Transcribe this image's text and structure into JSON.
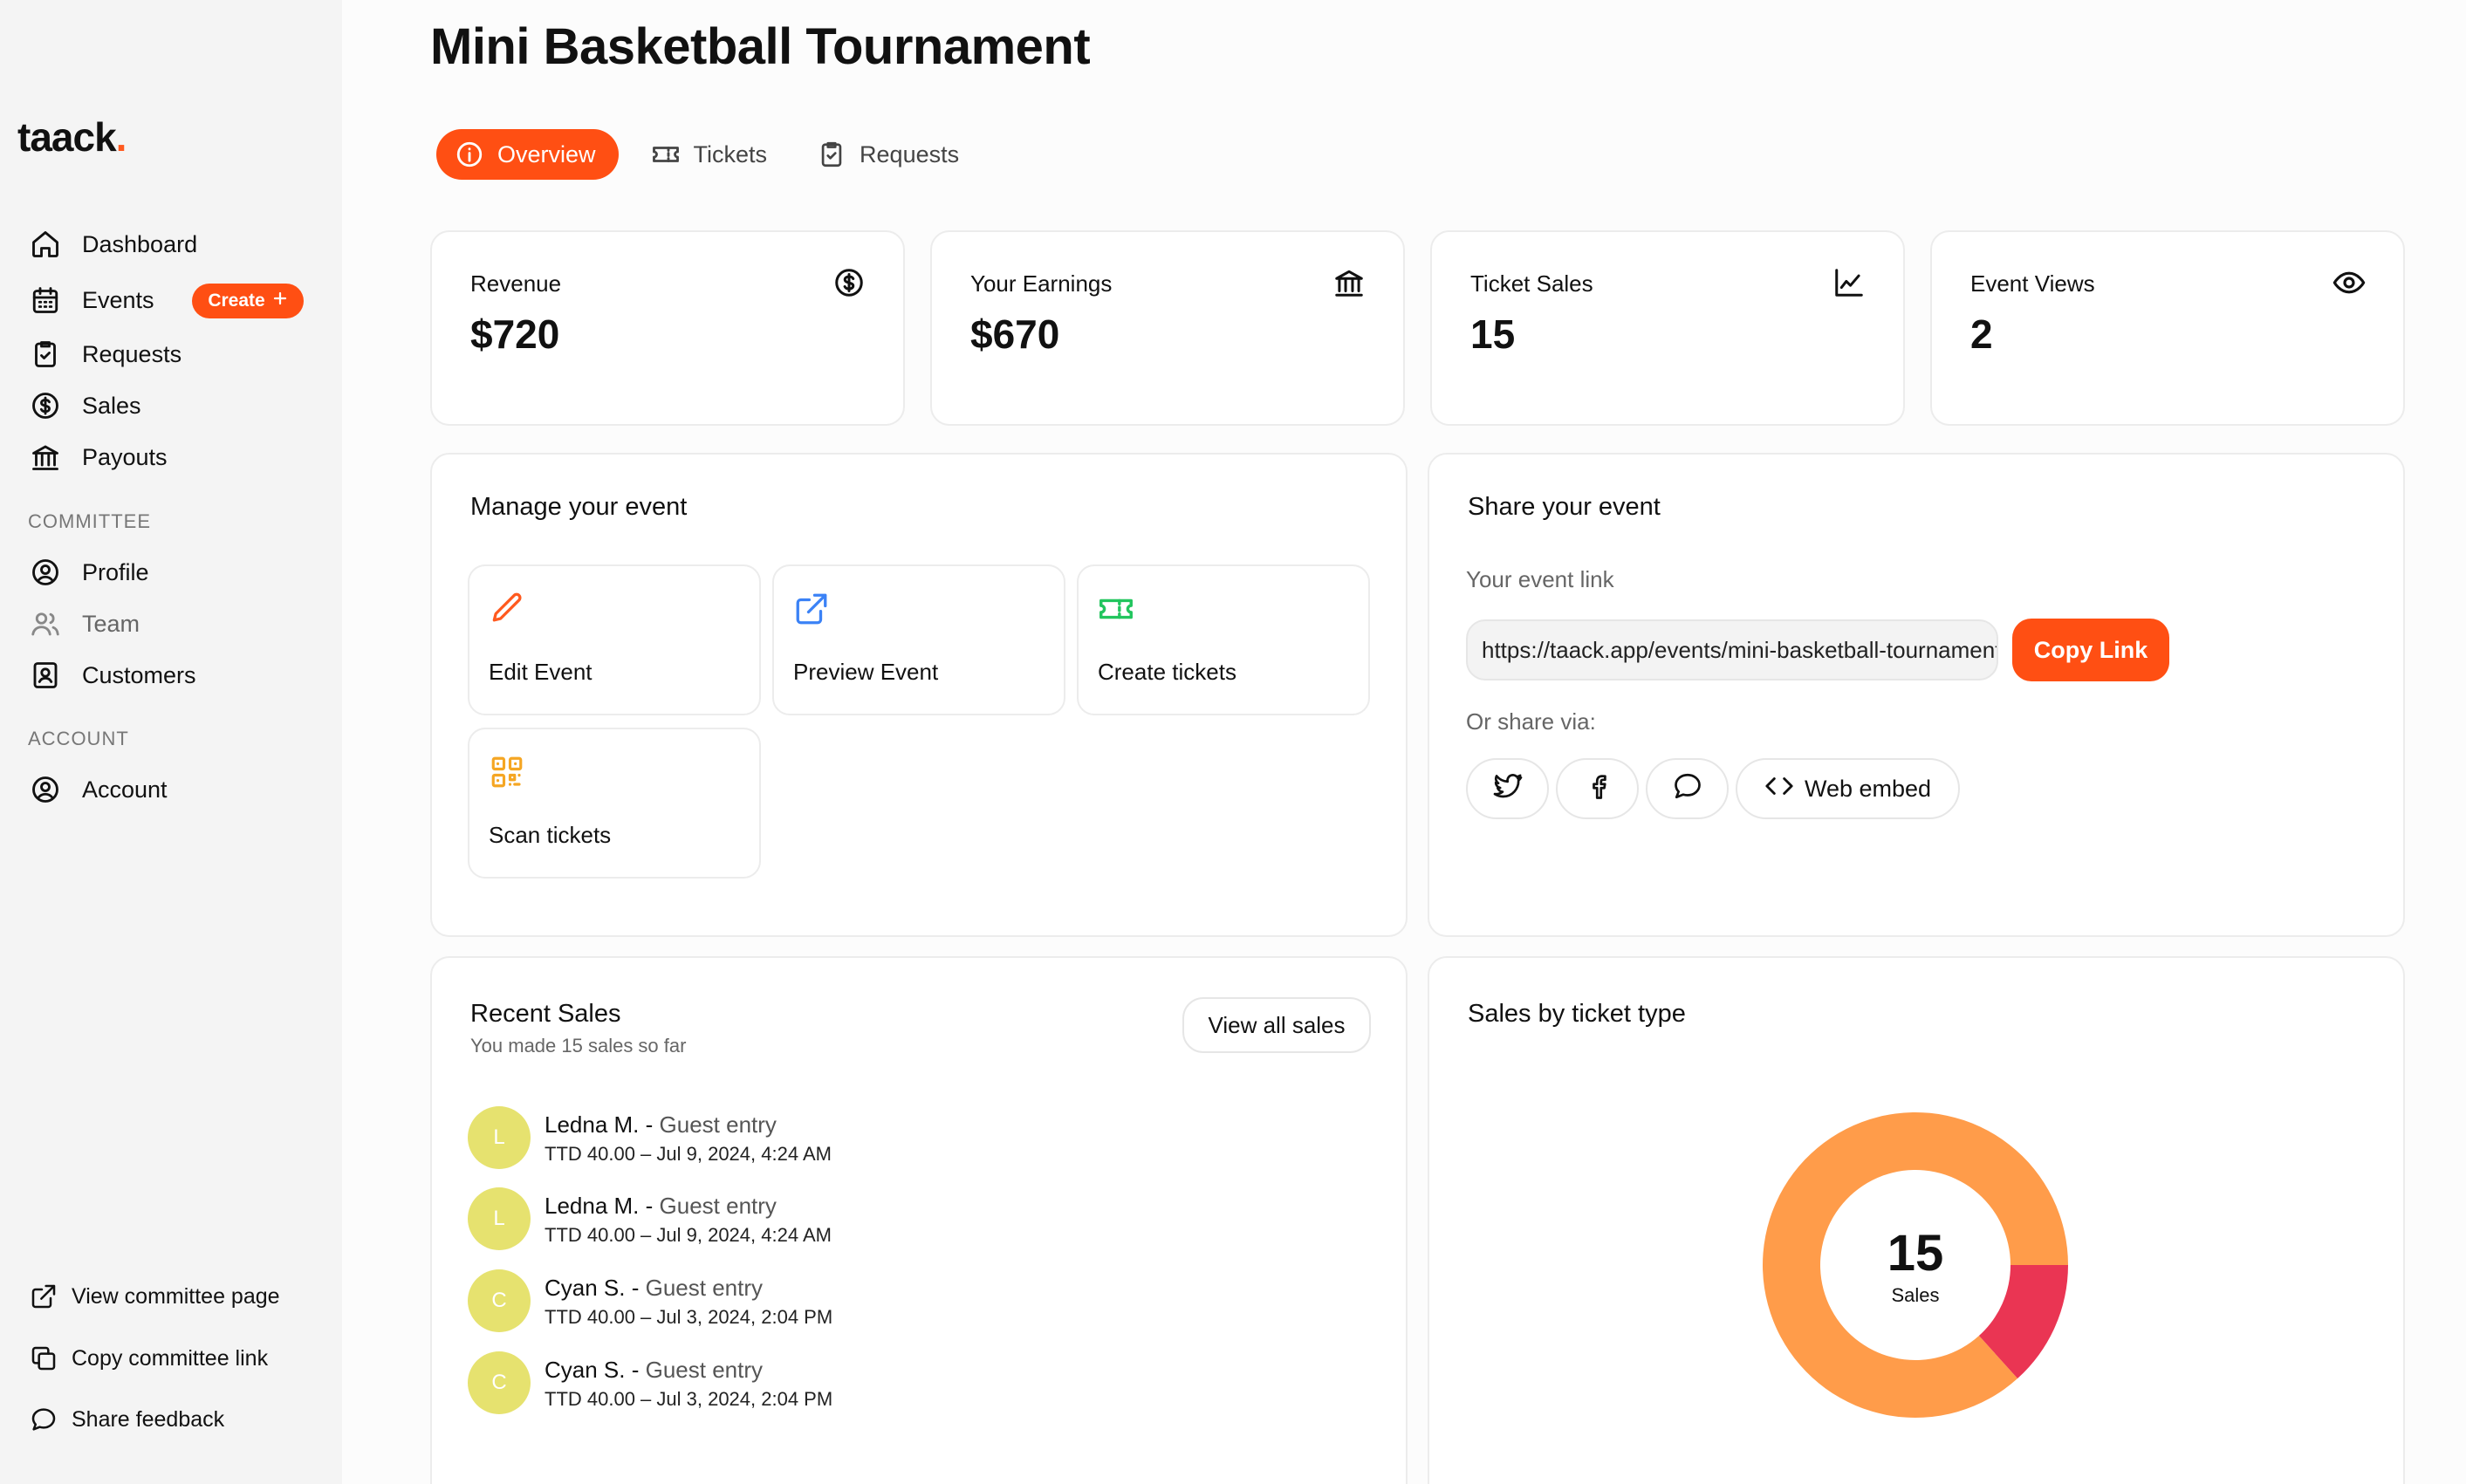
{
  "sidebar": {
    "logo_text": "taack",
    "logo_dot": ".",
    "items": [
      {
        "label": "Dashboard",
        "icon": "home-icon"
      },
      {
        "label": "Events",
        "icon": "calendar-icon"
      },
      {
        "label": "Requests",
        "icon": "clipboard-check-icon"
      },
      {
        "label": "Sales",
        "icon": "dollar-circle-icon"
      },
      {
        "label": "Payouts",
        "icon": "bank-icon"
      }
    ],
    "create_label": "Create",
    "sections": {
      "committee": {
        "title": "COMMITTEE",
        "items": [
          {
            "label": "Profile",
            "icon": "user-circle-icon"
          },
          {
            "label": "Team",
            "icon": "users-icon"
          },
          {
            "label": "Customers",
            "icon": "contact-book-icon"
          }
        ]
      },
      "account": {
        "title": "ACCOUNT",
        "items": [
          {
            "label": "Account",
            "icon": "user-circle-icon"
          }
        ]
      }
    },
    "footer": [
      {
        "label": "View committee page",
        "icon": "external-link-icon"
      },
      {
        "label": "Copy committee link",
        "icon": "copy-icon"
      },
      {
        "label": "Share feedback",
        "icon": "chat-bubble-icon"
      }
    ]
  },
  "page": {
    "title": "Mini Basketball Tournament"
  },
  "tabs": [
    {
      "label": "Overview",
      "icon": "info-icon",
      "active": true
    },
    {
      "label": "Tickets",
      "icon": "ticket-icon",
      "active": false
    },
    {
      "label": "Requests",
      "icon": "clipboard-check-icon",
      "active": false
    }
  ],
  "stats": [
    {
      "label": "Revenue",
      "value": "$720",
      "icon": "dollar-circle-icon"
    },
    {
      "label": "Your Earnings",
      "value": "$670",
      "icon": "bank-icon"
    },
    {
      "label": "Ticket Sales",
      "value": "15",
      "icon": "line-chart-icon"
    },
    {
      "label": "Event Views",
      "value": "2",
      "icon": "eye-icon"
    }
  ],
  "manage": {
    "title": "Manage your event",
    "actions": [
      {
        "label": "Edit Event",
        "icon": "pencil-icon"
      },
      {
        "label": "Preview Event",
        "icon": "external-link-icon"
      },
      {
        "label": "Create tickets",
        "icon": "ticket-icon"
      },
      {
        "label": "Scan tickets",
        "icon": "qr-code-icon"
      }
    ]
  },
  "share": {
    "title": "Share your event",
    "link_label": "Your event link",
    "link_value": "https://taack.app/events/mini-basketball-tournament",
    "copy_label": "Copy Link",
    "share_via_label": "Or share via:",
    "web_embed_label": "Web embed"
  },
  "recent_sales": {
    "title": "Recent Sales",
    "subtitle": "You made 15 sales so far",
    "view_all_label": "View all sales",
    "items": [
      {
        "initial": "L",
        "name": "Ledna M. -",
        "ticket": " Guest entry",
        "detail": "TTD 40.00  –  Jul 9, 2024, 4:24 AM"
      },
      {
        "initial": "L",
        "name": "Ledna M. -",
        "ticket": " Guest entry",
        "detail": "TTD 40.00  –  Jul 9, 2024, 4:24 AM"
      },
      {
        "initial": "C",
        "name": "Cyan S. -",
        "ticket": " Guest entry",
        "detail": "TTD 40.00  –  Jul 3, 2024, 2:04 PM"
      },
      {
        "initial": "C",
        "name": "Cyan S. -",
        "ticket": " Guest entry",
        "detail": "TTD 40.00  –  Jul 3, 2024, 2:04 PM"
      }
    ]
  },
  "sales_by_type": {
    "title": "Sales by ticket type",
    "total": "15",
    "total_label": "Sales"
  },
  "chart_data": {
    "type": "pie",
    "values": [
      13,
      2
    ],
    "colors": [
      "#ff9c4a",
      "#ea3553"
    ],
    "center_text": "15",
    "center_subtext": "Sales"
  },
  "colors": {
    "accent": "#ff4f13",
    "avatar": "#e6e26f"
  }
}
